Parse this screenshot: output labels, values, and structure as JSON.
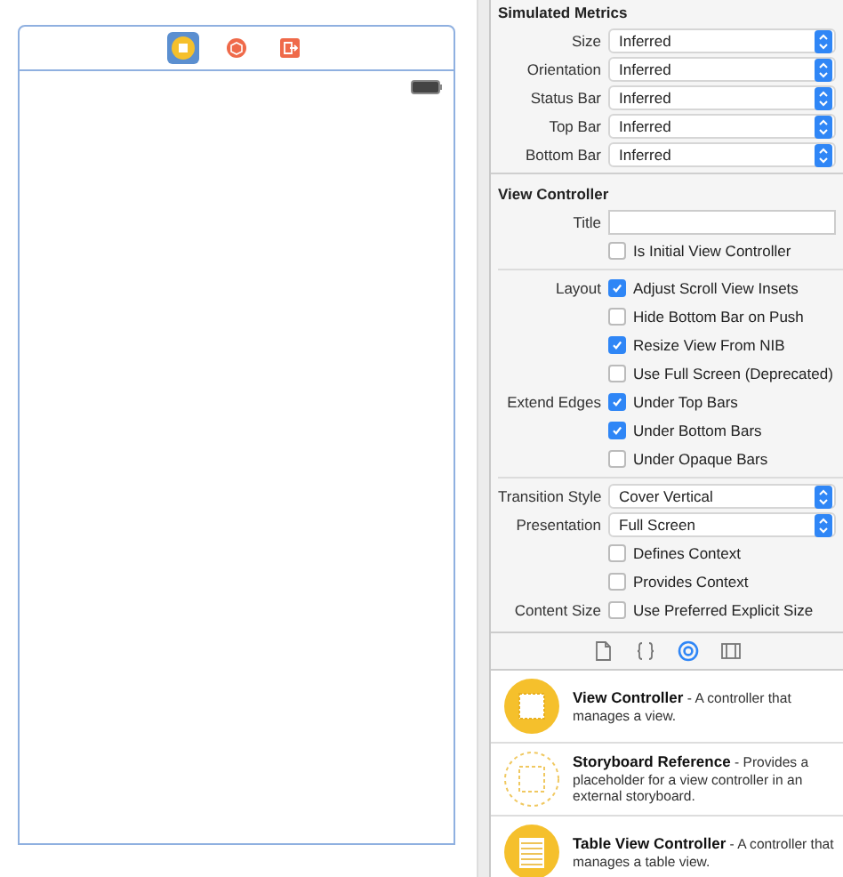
{
  "scene_dock": [
    {
      "kind": "controller",
      "selected": true
    },
    {
      "kind": "cube",
      "selected": false
    },
    {
      "kind": "exit",
      "selected": false
    }
  ],
  "inspector": {
    "sections": [
      {
        "title": "Simulated Metrics",
        "groups": [
          [
            {
              "kind": "popup",
              "label": "Size",
              "value": "Inferred"
            },
            {
              "kind": "popup",
              "label": "Orientation",
              "value": "Inferred"
            },
            {
              "kind": "popup",
              "label": "Status Bar",
              "value": "Inferred"
            },
            {
              "kind": "popup",
              "label": "Top Bar",
              "value": "Inferred"
            },
            {
              "kind": "popup",
              "label": "Bottom Bar",
              "value": "Inferred"
            }
          ]
        ]
      },
      {
        "title": "View Controller",
        "groups": [
          [
            {
              "kind": "text",
              "label": "Title"
            },
            {
              "kind": "checkbox",
              "text": "Is Initial View Controller",
              "checked": false
            }
          ],
          [
            {
              "kind": "checkbox",
              "label": "Layout",
              "text": "Adjust Scroll View Insets",
              "checked": true
            },
            {
              "kind": "checkbox",
              "text": "Hide Bottom Bar on Push",
              "checked": false
            },
            {
              "kind": "checkbox",
              "text": "Resize View From NIB",
              "checked": true
            },
            {
              "kind": "checkbox",
              "text": "Use Full Screen (Deprecated)",
              "checked": false
            },
            {
              "kind": "checkbox",
              "label": "Extend Edges",
              "text": "Under Top Bars",
              "checked": true
            },
            {
              "kind": "checkbox",
              "text": "Under Bottom Bars",
              "checked": true
            },
            {
              "kind": "checkbox",
              "text": "Under Opaque Bars",
              "checked": false
            }
          ],
          [
            {
              "kind": "popup",
              "label": "Transition Style",
              "value": "Cover Vertical"
            },
            {
              "kind": "popup",
              "label": "Presentation",
              "value": "Full Screen"
            },
            {
              "kind": "checkbox",
              "text": "Defines Context",
              "checked": false
            },
            {
              "kind": "checkbox",
              "text": "Provides Context",
              "checked": false
            },
            {
              "kind": "checkbox",
              "label": "Content Size",
              "text": "Use Preferred Explicit Size",
              "checked": false
            }
          ]
        ]
      }
    ]
  },
  "library_tabs": [
    {
      "kind": "file",
      "selected": false
    },
    {
      "kind": "braces",
      "selected": false
    },
    {
      "kind": "target",
      "selected": true
    },
    {
      "kind": "panel",
      "selected": false
    }
  ],
  "library": [
    {
      "kind": "view-controller",
      "text": "**View Controller** - A controller that manages a view."
    },
    {
      "kind": "storyboard-reference",
      "text": "**Storyboard Reference** - Provides a placeholder for a view controller in an external storyboard."
    },
    {
      "kind": "table-view-controller",
      "text": "**Table View Controller** - A controller that manages a table view."
    }
  ]
}
